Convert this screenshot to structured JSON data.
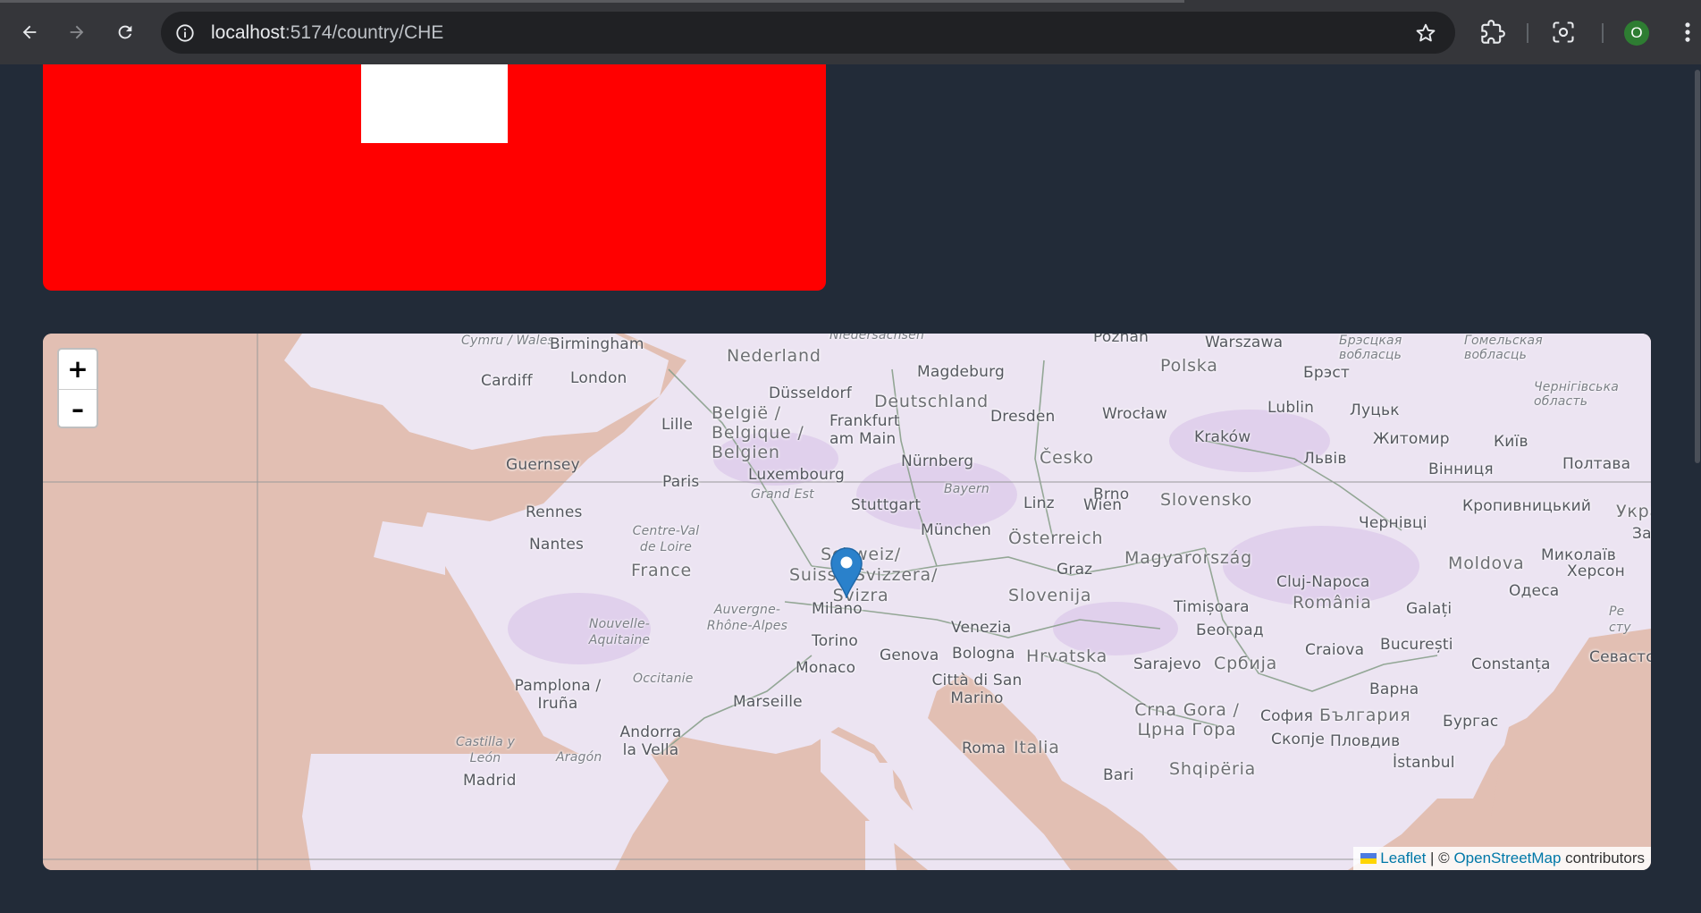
{
  "browser": {
    "url_host": "localhost",
    "url_path": ":5174/country/CHE",
    "profile_initial": "O",
    "icons": [
      "back-icon",
      "forward-icon",
      "reload-icon",
      "info-icon",
      "star-icon",
      "extensions-icon",
      "screenshot-icon",
      "menu-icon"
    ]
  },
  "flag": {
    "country_code": "CHE",
    "colors": {
      "field": "#ff0000",
      "cross": "#ffffff"
    }
  },
  "map": {
    "zoom_in_label": "+",
    "zoom_out_label": "–",
    "attribution": {
      "leaflet_label": "Leaflet",
      "separator": " | © ",
      "osm_label": "OpenStreetMap",
      "suffix": " contributors"
    },
    "labels": {
      "cymru_wales": "Cymru / Wales",
      "birmingham": "Birmingham",
      "cardiff": "Cardiff",
      "london": "London",
      "nederland": "Nederland",
      "niedersachsen": "Niedersachsen",
      "magdeburg": "Magdeburg",
      "poznan": "Poznań",
      "warszawa": "Warszawa",
      "polska": "Polska",
      "brestskaya": "Брэсцкая вобласць",
      "gomel": "Гомельская вобласць",
      "brest": "Брэст",
      "chernihiv": "Чернігівська область",
      "dusseldorf": "Düsseldorf",
      "deutschland": "Deutschland",
      "lille": "Lille",
      "belgie": "België / Belgique / Belgien",
      "frankfurt": "Frankfurt am Main",
      "dresden": "Dresden",
      "wroclaw": "Wrocław",
      "lublin": "Lublin",
      "lutsk": "Луцьк",
      "krakow": "Kraków",
      "zhytomyr": "Житомир",
      "kyiv": "Київ",
      "guernsey": "Guernsey",
      "luxembourg": "Luxembourg",
      "nurnberg": "Nürnberg",
      "cesko": "Česko",
      "lviv": "Львів",
      "poltava": "Полтава",
      "vinnytsia": "Вінниця",
      "paris": "Paris",
      "grand_est": "Grand Est",
      "bayern": "Bayern",
      "brno": "Brno",
      "rennes": "Rennes",
      "stuttgart": "Stuttgart",
      "linz": "Linz",
      "wien": "Wien",
      "slovensko": "Slovensko",
      "kropyvnytskyi": "Кропивницький",
      "ukraina": "Украї",
      "centre_val": "Centre-Val de Loire",
      "munchen": "München",
      "osterreich": "Österreich",
      "chernivtsi": "Чернівці",
      "nantes": "Nantes",
      "schweiz": "Schweiz/ Suisse/Svizzera/ Svizra",
      "magyarorszag": "Magyarország",
      "moldova": "Moldova",
      "mykolaiv": "Миколаїв",
      "za": "За",
      "france": "France",
      "graz": "Graz",
      "cluj": "Cluj-Napoca",
      "kherson": "Херсон",
      "odesa": "Одеса",
      "slovenija": "Slovenija",
      "romania": "România",
      "auvergne": "Auvergne-Rhône-Alpes",
      "milano": "Milano",
      "timisoara": "Timișoara",
      "galati": "Galați",
      "nouvelle": "Nouvelle-Aquitaine",
      "venezia": "Venezia",
      "beograd": "Београд",
      "torino": "Torino",
      "pe": "Ре сту",
      "genova": "Genova",
      "bologna": "Bologna",
      "hrvatska": "Hrvatska",
      "sarajevo": "Sarajevo",
      "srbija": "Србија",
      "craiova": "Craiova",
      "bucuresti": "București",
      "constanta": "Constanța",
      "sevastopol": "Севастс",
      "monaco": "Monaco",
      "occitanie": "Occitanie",
      "pamplona": "Pamplona / Iruña",
      "citta": "Città di San Marino",
      "varna": "Варна",
      "marseille": "Marseille",
      "crna_gora": "Crna Gora / Црна Гора",
      "sofia": "София",
      "balgaria": "България",
      "burgas": "Бургас",
      "andorra": "Andorra la Vella",
      "castilla": "Castilla y León",
      "aragon": "Aragón",
      "skopje": "Скопје",
      "plovdiv": "Пловдив",
      "roma": "Roma",
      "italia": "Italia",
      "istanbul": "İstanbul",
      "shqiperia": "Shqipëria",
      "bari": "Bari",
      "madrid": "Madrid"
    }
  }
}
